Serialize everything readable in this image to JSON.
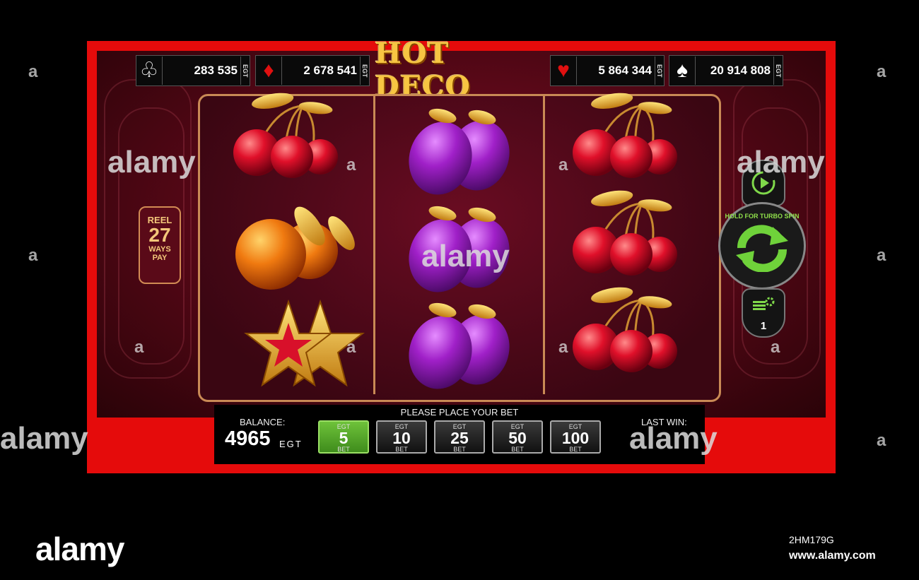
{
  "title": "HOT DECO",
  "jackpots": [
    {
      "suit": "♧",
      "value": "283 535",
      "currency": "EGT",
      "color": "#ffffff"
    },
    {
      "suit": "♦",
      "value": "2 678 541",
      "currency": "EGT",
      "color": "#e01010"
    },
    {
      "suit": "♥",
      "value": "5 864 344",
      "currency": "EGT",
      "color": "#e01010"
    },
    {
      "suit": "♠",
      "value": "20 914 808",
      "currency": "EGT",
      "color": "#ffffff"
    }
  ],
  "ways_badge": {
    "line1": "REEL",
    "number": "27",
    "line2": "WAYS",
    "line3": "PAY"
  },
  "reels": [
    [
      "cherries",
      "orange",
      "star"
    ],
    [
      "plum",
      "plum",
      "plum"
    ],
    [
      "cherries",
      "cherries",
      "cherries"
    ]
  ],
  "controls": {
    "spin_hint": "HOLD FOR TURBO SPIN",
    "lines_value": "1"
  },
  "panel": {
    "prompt": "PLEASE PLACE YOUR BET",
    "balance_label": "BALANCE:",
    "balance_value": "4965",
    "balance_currency": "EGT",
    "last_win_label": "LAST WIN:",
    "bets": [
      {
        "currency": "EGT",
        "value": "5",
        "label": "BET",
        "selected": true
      },
      {
        "currency": "EGT",
        "value": "10",
        "label": "BET",
        "selected": false
      },
      {
        "currency": "EGT",
        "value": "25",
        "label": "BET",
        "selected": false
      },
      {
        "currency": "EGT",
        "value": "50",
        "label": "BET",
        "selected": false
      },
      {
        "currency": "EGT",
        "value": "100",
        "label": "BET",
        "selected": false
      }
    ]
  },
  "watermark": {
    "brand": "alamy",
    "letter": "a",
    "image_id": "2HM179G",
    "url": "www.alamy.com"
  },
  "colors": {
    "frame": "#e50b0b",
    "selected_bet": "#5aa82a",
    "gold": "#f7c542"
  }
}
